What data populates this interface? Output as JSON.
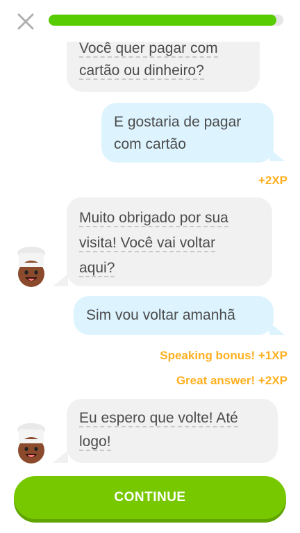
{
  "header": {
    "close_icon": "close-icon",
    "progress_fraction": 0.97,
    "accent_color": "#58cc02"
  },
  "messages": [
    {
      "side": "in",
      "lines": [
        "Você quer pagar com",
        "cartão ou dinheiro?"
      ]
    },
    {
      "side": "out",
      "lines": [
        "E gostaria de pagar",
        "com cartão"
      ]
    },
    {
      "side": "xp",
      "text": "+2XP"
    },
    {
      "side": "in",
      "lines": [
        "Muito obrigado por sua",
        "visita! Você vai voltar",
        "aqui?"
      ]
    },
    {
      "side": "out",
      "lines": [
        "Sim vou voltar amanhã"
      ]
    },
    {
      "side": "xp",
      "text": "Speaking bonus! +1XP"
    },
    {
      "side": "xp",
      "text": "Great answer! +2XP"
    },
    {
      "side": "in",
      "lines": [
        "Eu espero que volte! Até",
        "logo!"
      ]
    }
  ],
  "footer": {
    "continue_label": "CONTINUE"
  }
}
